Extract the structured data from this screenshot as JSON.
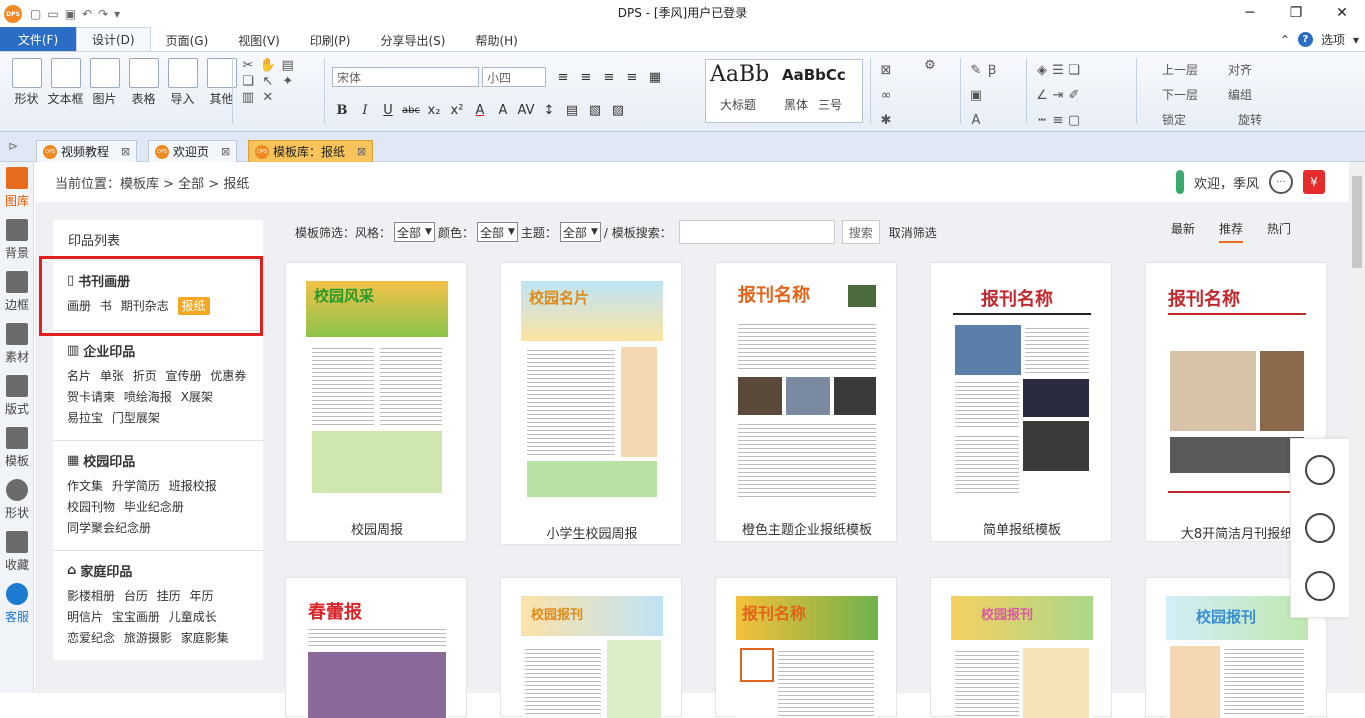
{
  "window": {
    "title": "DPS - [季风]用户已登录",
    "logo": "DPS"
  },
  "menu": {
    "file": "文件(F)",
    "tabs": [
      "设计(D)",
      "页面(G)",
      "视图(V)",
      "印刷(P)",
      "分享导出(S)",
      "帮助(H)"
    ],
    "options": "选项"
  },
  "ribbon": {
    "insert_buttons": [
      "形状",
      "文本框",
      "图片",
      "表格",
      "导入",
      "其他"
    ],
    "font_name": "宋体",
    "font_size": "小四",
    "styles": [
      "AaBb",
      "AaBbCc",
      "大标题",
      "黑体",
      "三号"
    ],
    "arrange": [
      "上一层",
      "对齐",
      "下一层",
      "编组",
      "锁定",
      "旋转"
    ]
  },
  "doc_tabs": [
    "视频教程",
    "欢迎页",
    "模板库：报纸"
  ],
  "left_nav": [
    "图库",
    "背景",
    "边框",
    "素材",
    "版式",
    "模板",
    "形状",
    "收藏",
    "客服"
  ],
  "breadcrumb": "当前位置：模板库 > 全部 > 报纸",
  "user": {
    "welcome": "欢迎，季风"
  },
  "categories": {
    "title": "印品列表",
    "sections": [
      {
        "name": "书刊画册",
        "items": [
          "画册",
          "书",
          "期刊杂志",
          "报纸"
        ]
      },
      {
        "name": "企业印品",
        "items": [
          "名片",
          "单张",
          "折页",
          "宣传册",
          "优惠券",
          "贺卡请柬",
          "喷绘海报",
          "X展架",
          "易拉宝",
          "门型展架"
        ]
      },
      {
        "name": "校园印品",
        "items": [
          "作文集",
          "升学简历",
          "班报校报",
          "校园刊物",
          "毕业纪念册",
          "同学聚会纪念册"
        ]
      },
      {
        "name": "家庭印品",
        "items": [
          "影楼相册",
          "台历",
          "挂历",
          "年历",
          "明信片",
          "宝宝画册",
          "儿童成长",
          "恋爱纪念",
          "旅游摄影",
          "家庭影集"
        ]
      }
    ],
    "selected": "报纸"
  },
  "filter": {
    "label": "模板筛选：风格：",
    "style_value": "全部",
    "color_label": "颜色：",
    "color_value": "全部",
    "theme_label": "主题：",
    "theme_value": "全部",
    "search_label": "/ 模板搜索：",
    "search_button": "搜索",
    "clear": "取消筛选"
  },
  "sort": [
    "最新",
    "推荐",
    "热门"
  ],
  "templates": [
    {
      "caption": "校园周报",
      "head": "校园风采",
      "color": "#2a9a2a"
    },
    {
      "caption": "小学生校园周报",
      "head": "校园名片",
      "color": "#e08a1a"
    },
    {
      "caption": "橙色主题企业报纸模板",
      "head": "报刊名称",
      "color": "#e2641a"
    },
    {
      "caption": "简单报纸模板",
      "head": "报刊名称",
      "color": "#c0282d"
    },
    {
      "caption": "大8开简洁月刊报纸",
      "head": "报刊名称",
      "color": "#c0282d"
    },
    {
      "caption": "",
      "head": "春蕾报",
      "color": "#d8262b"
    },
    {
      "caption": "",
      "head": "校园报刊",
      "color": "#e08a1a"
    },
    {
      "caption": "",
      "head": "报刊名称",
      "color": "#e2641a"
    },
    {
      "caption": "",
      "head": "校园报刊",
      "color": "#d85aa0"
    },
    {
      "caption": "",
      "head": "校园报刊",
      "color": "#3a8fd1"
    }
  ]
}
